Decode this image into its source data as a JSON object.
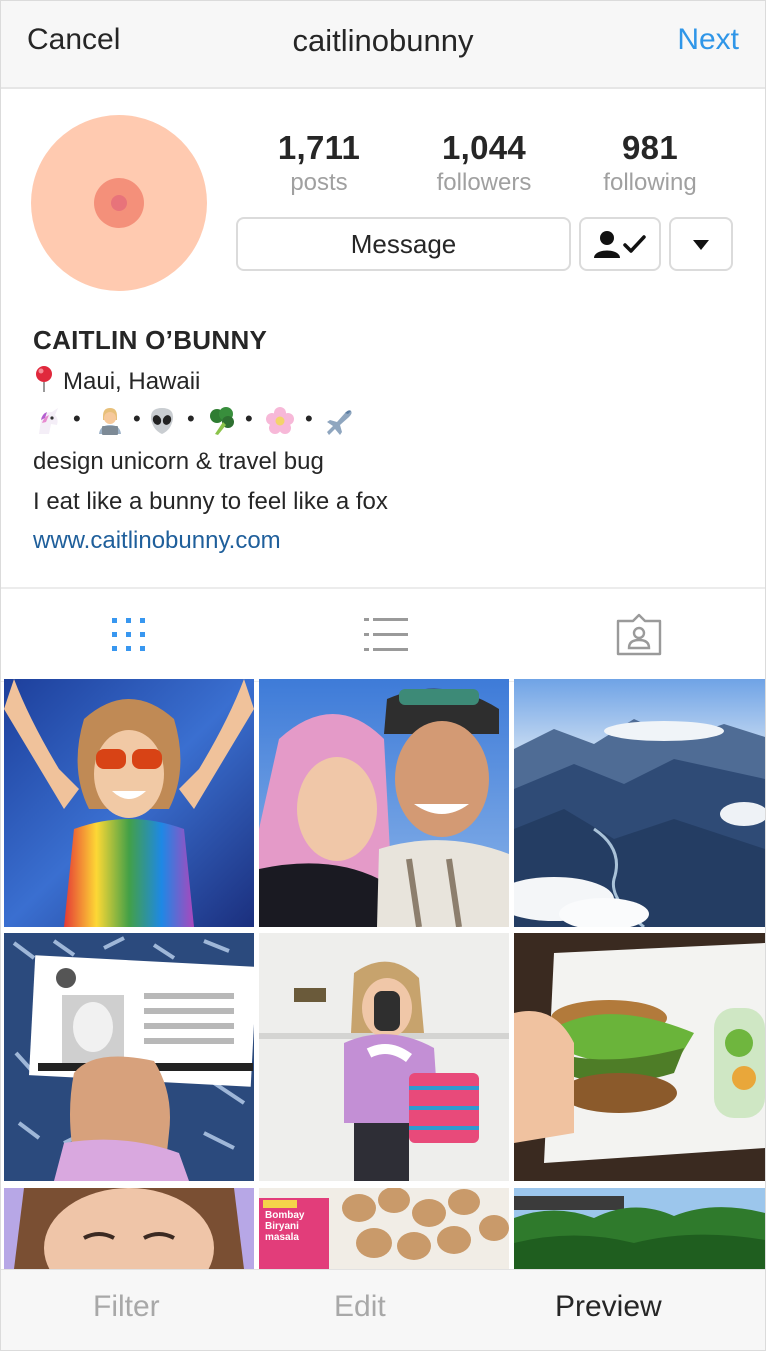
{
  "topbar": {
    "cancel": "Cancel",
    "title": "caitlinobunny",
    "next": "Next",
    "next_color": "#2f96e8"
  },
  "profile": {
    "stats": [
      {
        "value": "1,711",
        "label": "posts"
      },
      {
        "value": "1,044",
        "label": "followers"
      },
      {
        "value": "981",
        "label": "following"
      }
    ],
    "message_button": "Message",
    "follow_icon": "person-check-icon",
    "more_icon": "caret-down-icon"
  },
  "bio": {
    "name": "CAITLIN O’BUNNY",
    "location_icon": "map-pin-icon",
    "location": "Maui, Hawaii",
    "emoji_line": [
      "unicorn-icon",
      "technologist-icon",
      "alien-icon",
      "broccoli-icon",
      "flower-icon",
      "airplane-icon"
    ],
    "separator": "•",
    "line1": "design unicorn & travel bug",
    "line2": "I eat like a bunny to feel like a fox",
    "link": "www.caitlinobunny.com",
    "link_color": "#1f5f9b"
  },
  "tabs": [
    {
      "icon": "grid-icon",
      "active": true
    },
    {
      "icon": "list-icon",
      "active": false
    },
    {
      "icon": "tagged-photos-icon",
      "active": false
    }
  ],
  "grid": [
    {
      "name": "photo-tie-dye-selfie"
    },
    {
      "name": "photo-couple-selfie"
    },
    {
      "name": "photo-mountains-aerial"
    },
    {
      "name": "photo-customs-card"
    },
    {
      "name": "photo-mirror-selfie"
    },
    {
      "name": "photo-veggie-burger"
    },
    {
      "name": "photo-face-closeup"
    },
    {
      "name": "photo-biryani-potatoes"
    },
    {
      "name": "photo-tropical-trees"
    }
  ],
  "grid_caption_text": {
    "biryani_box": "Bombay Biryani masala"
  },
  "bottombar": {
    "filter": "Filter",
    "edit": "Edit",
    "preview": "Preview"
  }
}
